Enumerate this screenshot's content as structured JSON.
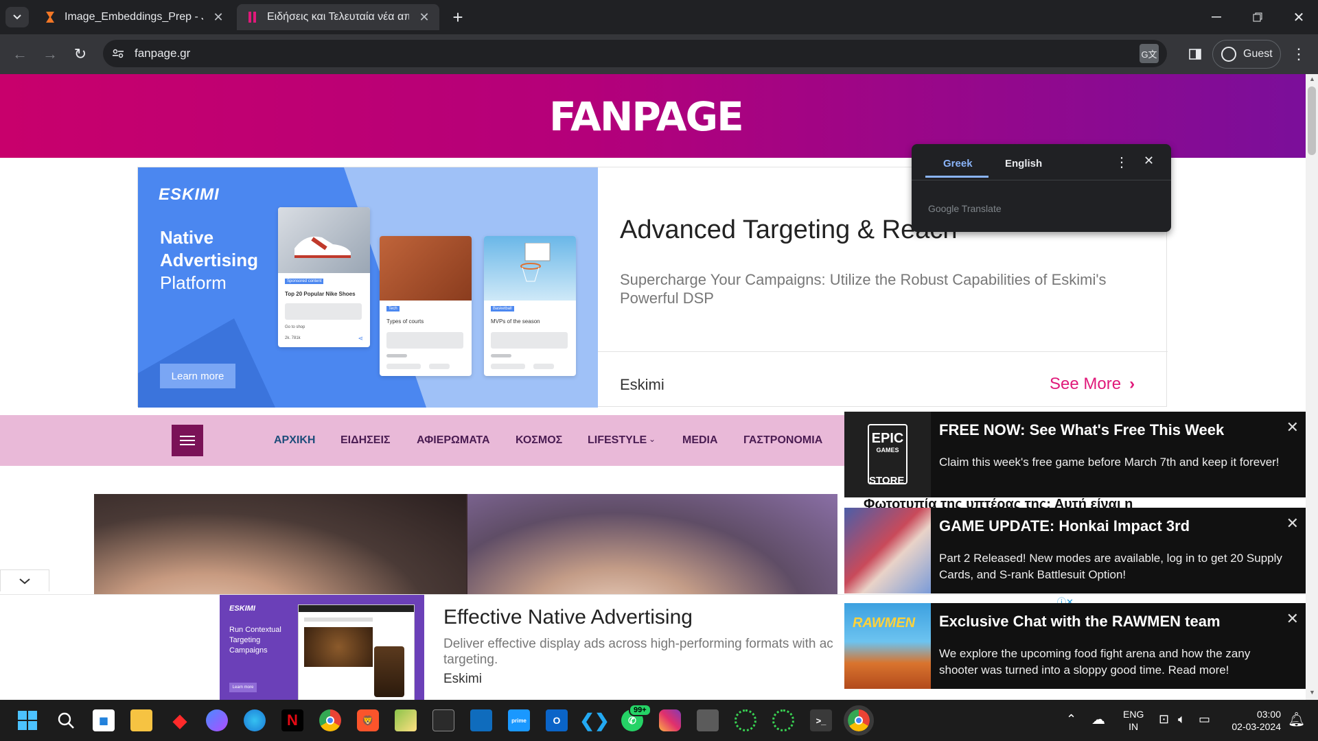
{
  "browser": {
    "tabs": [
      {
        "title": "Image_Embeddings_Prep - Jupy",
        "active": false
      },
      {
        "title": "Ειδήσεις και Τελευταία νέα από",
        "active": true
      }
    ],
    "new_tab": "+",
    "url": "fanpage.gr",
    "profile": "Guest"
  },
  "translate_popup": {
    "tab_source": "Greek",
    "tab_target": "English",
    "footer": "Google Translate"
  },
  "site": {
    "logo": "FANPAGE",
    "nav": [
      "ΑΡΧΙΚΗ",
      "ΕΙΔΗΣΕΙΣ",
      "ΑΦΙΕΡΩΜΑΤΑ",
      "ΚΟΣΜΟΣ",
      "LIFESTYLE",
      "MEDIA",
      "ΓΑΣΤΡΟΝΟΜΙΑ"
    ],
    "article_peek": "Φωτοτυπία της υπτέρας της: Αυτή είναι η"
  },
  "ad_top": {
    "brand": "ESKIMI",
    "tagline_1": "Native",
    "tagline_2": "Advertising",
    "tagline_3": "Platform",
    "cta": "Learn more",
    "card1_tag": "Sponsored content",
    "card1_title": "Top 20 Popular Nike Shoes",
    "card1_meta1": "Go to shop",
    "card1_meta2": "2k. 781k",
    "card2_tag": "Tech",
    "card2_title": "Types of courts",
    "card3_tag": "Basketball",
    "card3_title": "MVPs of the season",
    "headline": "Advanced Targeting & Reach",
    "body": "Supercharge Your Campaigns: Utilize the Robust Capabilities of Eskimi's Powerful DSP",
    "advertiser": "Eskimi",
    "see_more": "See More"
  },
  "ad_bottom": {
    "brand": "ESKIMI",
    "tagline": "Run Contextual Targeting Campaigns",
    "cta": "Learn more",
    "headline": "Effective Native Advertising",
    "body": "Deliver effective display ads across high-performing formats with ac targeting.",
    "advertiser": "Eskimi"
  },
  "toasts": [
    {
      "title": "FREE NOW: See What's Free This Week",
      "desc": "Claim this week's free game before March 7th and keep it forever!",
      "img": "epic-games-store-logo"
    },
    {
      "title": "GAME UPDATE: Honkai Impact 3rd",
      "desc": "Part 2 Released! New modes are available, log in to get 20 Supply Cards, and S-rank Battlesuit Option!",
      "img": "honkai-art"
    },
    {
      "title": "Exclusive Chat with the RAWMEN team",
      "desc": "We explore the upcoming food fight arena and how the zany shooter was turned into a sloppy good time. Read more!",
      "img": "rawmen-art"
    }
  ],
  "epic": {
    "l1": "EPIC",
    "l2": "GAMES",
    "l3": "STORE"
  },
  "rawmen_logo": "RAWMEN",
  "taskbar": {
    "whatsapp_badge": "99+",
    "lang_1": "ENG",
    "lang_2": "IN",
    "time": "03:00",
    "date": "02-03-2024"
  },
  "colors": {
    "brand_gradient_start": "#c8006c",
    "brand_gradient_end": "#7b0e9a",
    "nav_bg": "#e9b9d8",
    "see_more": "#e0197a",
    "ad_blue": "#4b87f0"
  }
}
